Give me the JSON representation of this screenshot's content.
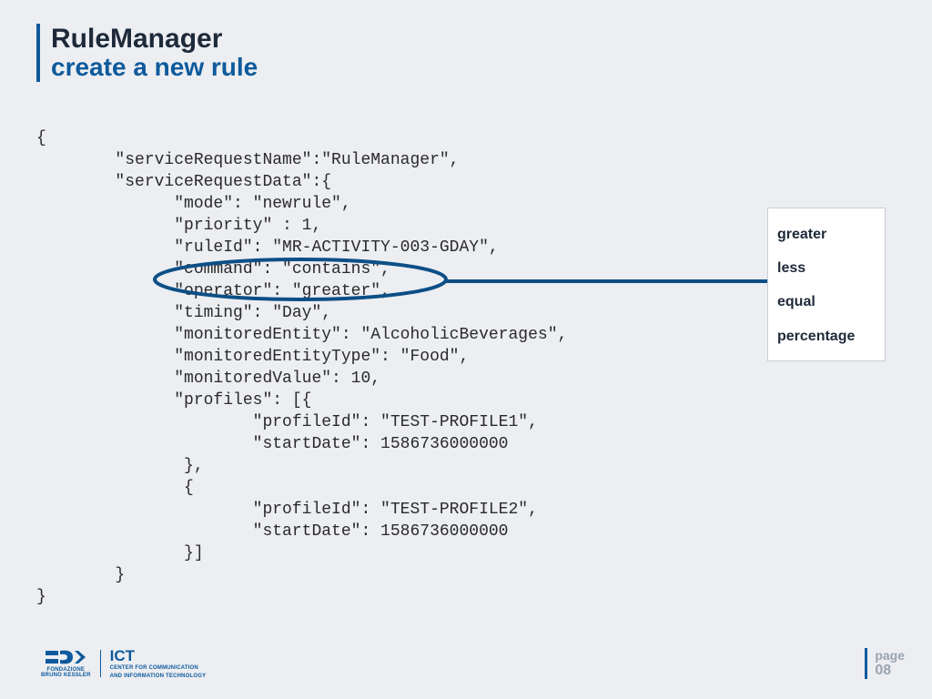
{
  "title": {
    "main": "RuleManager",
    "sub": "create a new rule"
  },
  "code": "{\n        \"serviceRequestName\":\"RuleManager\",\n        \"serviceRequestData\":{\n              \"mode\": \"newrule\",\n              \"priority\" : 1,\n              \"ruleId\": \"MR-ACTIVITY-003-GDAY\",\n              \"command\": \"contains\",\n              \"operator\": \"greater\",\n              \"timing\": \"Day\",\n              \"monitoredEntity\": \"AlcoholicBeverages\",\n              \"monitoredEntityType\": \"Food\",\n              \"monitoredValue\": 10,\n              \"profiles\": [{\n                      \"profileId\": \"TEST-PROFILE1\",\n                      \"startDate\": 1586736000000\n               },\n               {\n                      \"profileId\": \"TEST-PROFILE2\",\n                      \"startDate\": 1586736000000\n               }]\n        }\n}",
  "callout": {
    "options": [
      "greater",
      "less",
      "equal",
      "percentage"
    ]
  },
  "footer": {
    "org_line1": "FONDAZIONE",
    "org_line2": "BRUNO KESSLER",
    "dept": "ICT",
    "dept_sub1": "CENTER FOR COMMUNICATION",
    "dept_sub2": "AND INFORMATION TECHNOLOGY",
    "page_label": "page",
    "page_number": "08"
  },
  "colors": {
    "accent": "#0e5a9c",
    "bg": "#eceef2",
    "callout_stroke": "#0c4f86"
  }
}
